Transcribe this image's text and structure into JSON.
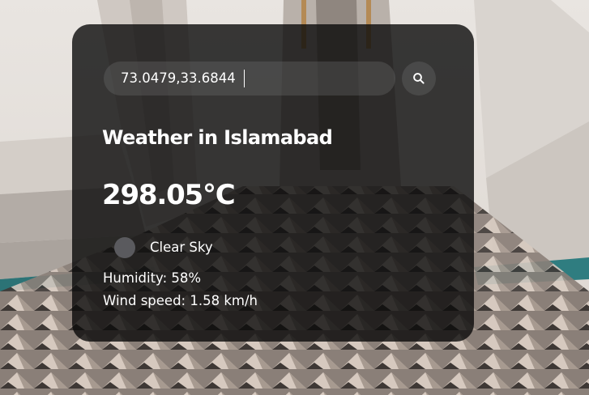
{
  "search": {
    "value": "73.0479,33.6844",
    "icon": "search-icon"
  },
  "weather": {
    "title": "Weather in Islamabad",
    "temperature": "298.05°C",
    "condition": "Clear Sky",
    "condition_icon": "weather-icon",
    "humidity": "Humidity: 58%",
    "wind": "Wind speed: 1.58 km/h"
  },
  "colors": {
    "card_background": "#0a0a0a",
    "text": "#ffffff"
  }
}
